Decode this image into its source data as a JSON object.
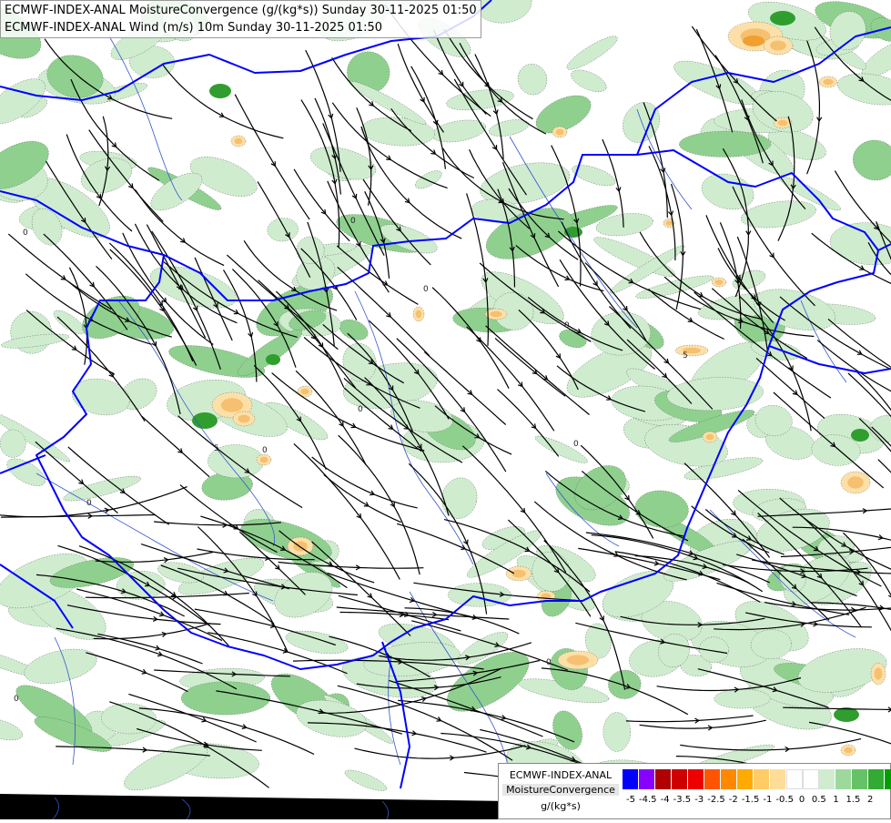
{
  "titles": [
    "ECMWF-INDEX-ANAL MoistureConvergence (g/(kg*s)) Sunday 30-11-2025 01:50",
    "ECMWF-INDEX-ANAL Wind (m/s) 10m Sunday 30-11-2025 01:50"
  ],
  "legend": {
    "line1": "ECMWF-INDEX-ANAL",
    "line2": "MoistureConvergence",
    "line3": "g/(kg*s)",
    "colors": [
      "#0000ff",
      "#8800ff",
      "#b00000",
      "#d00000",
      "#ee0000",
      "#ff5500",
      "#ff8800",
      "#ffaa00",
      "#ffcc66",
      "#ffdd99",
      "#ffffff",
      "#ffffff",
      "#cfeccf",
      "#9dd99d",
      "#66c266",
      "#33aa33",
      "#00a000"
    ],
    "ticks": [
      "-5",
      "-4.5",
      "-4",
      "-3.5",
      "-3",
      "-2.5",
      "-2",
      "-1.5",
      "-1",
      "-0.5",
      "0",
      "0.5",
      "1",
      "1.5",
      "2"
    ]
  },
  "colors": {
    "border": "#0000ff",
    "river": "#3355cc",
    "streamline": "#000000",
    "green_light": "#cfeccf",
    "green_mid": "#8fd08f",
    "green_dark": "#2f9e2f",
    "orange_light": "#fde0a8",
    "orange_mid": "#f5c070",
    "orange_dark": "#f0a030"
  }
}
